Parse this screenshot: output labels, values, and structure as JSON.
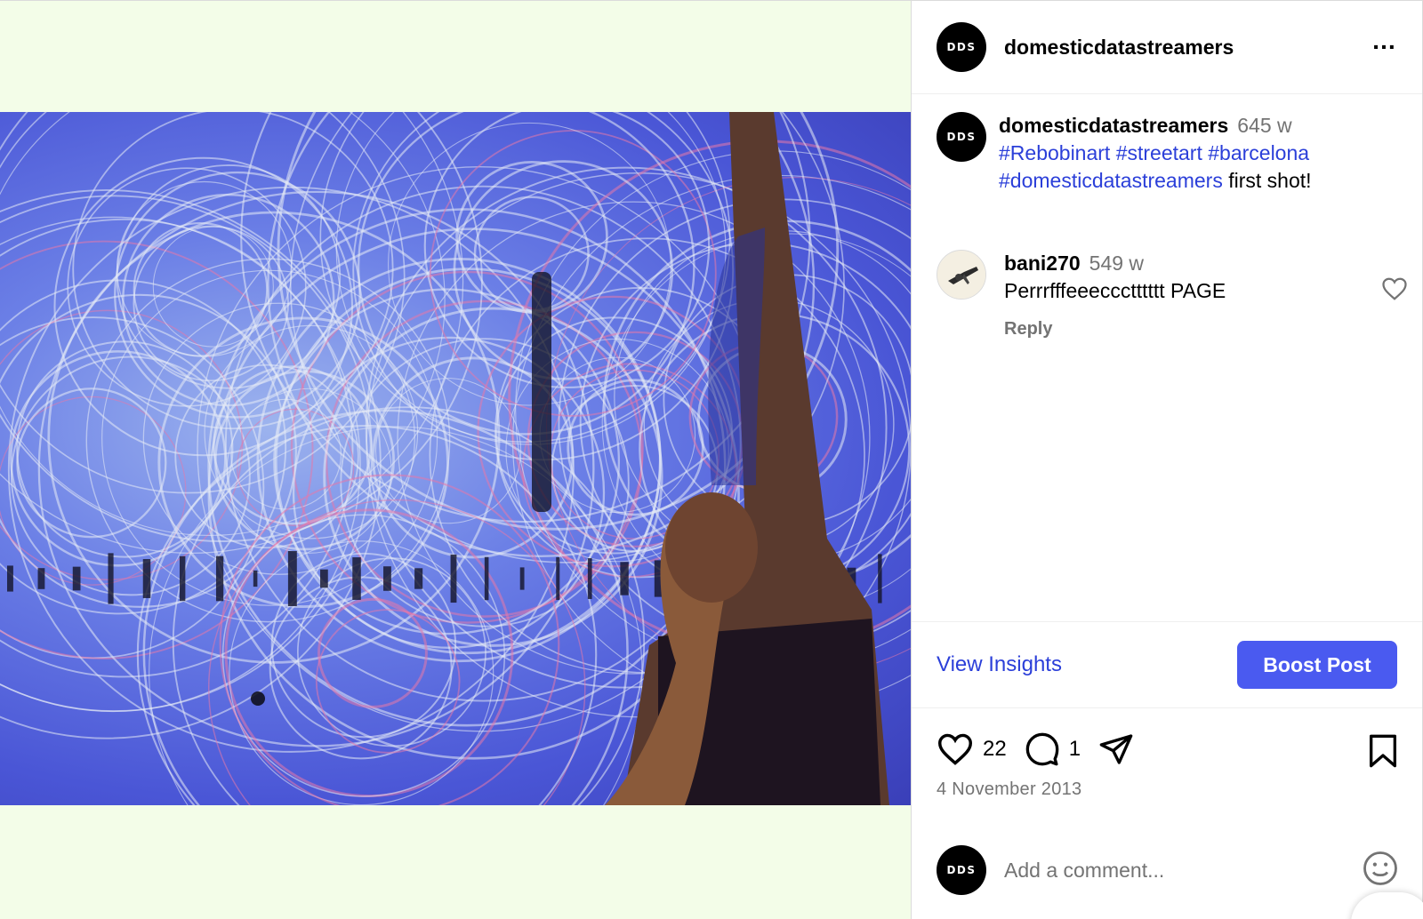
{
  "post": {
    "username": "domesticdatastreamers",
    "avatar_text": "DDS",
    "more_icon": "more-horizontal-icon"
  },
  "caption": {
    "username": "domesticdatastreamers",
    "time": "645 w",
    "tags": [
      "#Rebobinart",
      "#streetart",
      "#barcelona",
      "#domesticdatastreamers"
    ],
    "text": "first shot!"
  },
  "comment": {
    "username": "bani270",
    "time": "549 w",
    "text": "Perrrfffeeeccctttttt PAGE",
    "reply_label": "Reply"
  },
  "insights": {
    "view_label": "View Insights",
    "boost_label": "Boost Post"
  },
  "actions": {
    "likes": "22",
    "comments": "1",
    "date": "4 November 2013"
  },
  "add_comment": {
    "placeholder": "Add a comment..."
  },
  "colors": {
    "link": "#2b3fd9",
    "button": "#4a5af0",
    "media_bg": "#f3fde8"
  }
}
